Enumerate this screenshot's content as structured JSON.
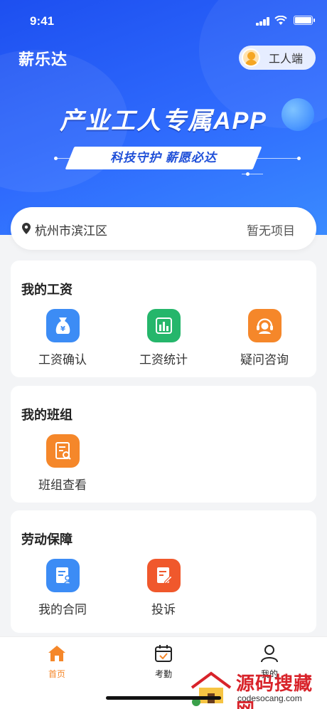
{
  "status_bar": {
    "time": "9:41"
  },
  "header": {
    "brand": "薪乐达",
    "role_label": "工人端"
  },
  "banner": {
    "slogan": "产业工人专属APP",
    "tagline": "科技守护 薪愿必达"
  },
  "location": {
    "city": "杭州市滨江区",
    "project": "暂无项目"
  },
  "salary": {
    "title": "我的工资",
    "items": [
      {
        "label": "工资确认",
        "icon": "money-bag-icon",
        "color": "#3c8cf5"
      },
      {
        "label": "工资统计",
        "icon": "bar-chart-icon",
        "color": "#25b66b"
      },
      {
        "label": "疑问咨询",
        "icon": "headset-icon",
        "color": "#f5872a"
      }
    ]
  },
  "team": {
    "title": "我的班组",
    "items": [
      {
        "label": "班组查看",
        "icon": "document-search-icon",
        "color": "#f5872a"
      }
    ]
  },
  "labor": {
    "title": "劳动保障",
    "items": [
      {
        "label": "我的合同",
        "icon": "contract-icon",
        "color": "#3c8cf5"
      },
      {
        "label": "投诉",
        "icon": "complaint-edit-icon",
        "color": "#f0582c"
      }
    ]
  },
  "tabbar": {
    "items": [
      {
        "label": "首页",
        "icon": "home-icon",
        "active": true
      },
      {
        "label": "考勤",
        "icon": "calendar-check-icon",
        "active": false
      },
      {
        "label": "我的",
        "icon": "user-icon",
        "active": false
      }
    ]
  },
  "watermark": {
    "title": "源码搜藏网",
    "domain": "codesocang.com"
  }
}
